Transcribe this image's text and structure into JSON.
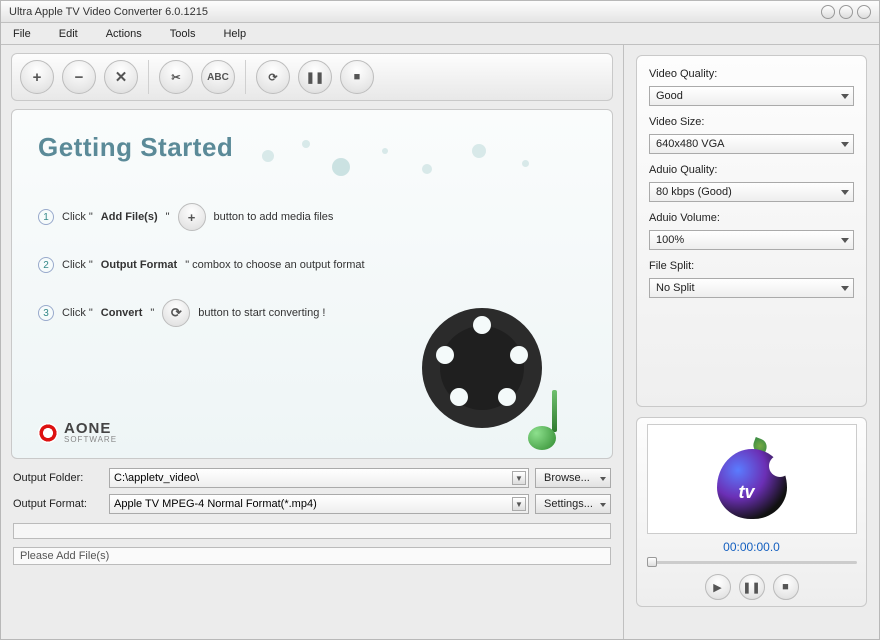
{
  "titlebar": {
    "title": "Ultra Apple TV Video Converter 6.0.1215"
  },
  "menu": {
    "file": "File",
    "edit": "Edit",
    "actions": "Actions",
    "tools": "Tools",
    "help": "Help"
  },
  "gs": {
    "title": "Getting Started",
    "step1_a": "Click \"",
    "step1_b": "Add File(s)",
    "step1_c": "\"",
    "step1_d": "button to add media files",
    "step2_a": "Click \"",
    "step2_b": "Output Format",
    "step2_c": "\" combox to choose an output format",
    "step3_a": "Click \"",
    "step3_b": "Convert",
    "step3_c": "\"",
    "step3_d": "button to start converting !"
  },
  "brand": {
    "name": "AONE",
    "sub": "SOFTWARE"
  },
  "out": {
    "folder_label": "Output Folder:",
    "folder_value": "C:\\appletv_video\\",
    "format_label": "Output Format:",
    "format_value": "Apple TV MPEG-4 Normal Format(*.mp4)",
    "browse": "Browse...",
    "settings": "Settings..."
  },
  "status": "Please Add File(s)",
  "settings": {
    "vq_label": "Video Quality:",
    "vq_value": "Good",
    "vs_label": "Video Size:",
    "vs_value": "640x480   VGA",
    "aq_label": "Aduio Quality:",
    "aq_value": "80  kbps (Good)",
    "av_label": "Aduio Volume:",
    "av_value": "100%",
    "fs_label": "File Split:",
    "fs_value": "No Split"
  },
  "preview": {
    "time": "00:00:00.0",
    "tv": "tv"
  }
}
